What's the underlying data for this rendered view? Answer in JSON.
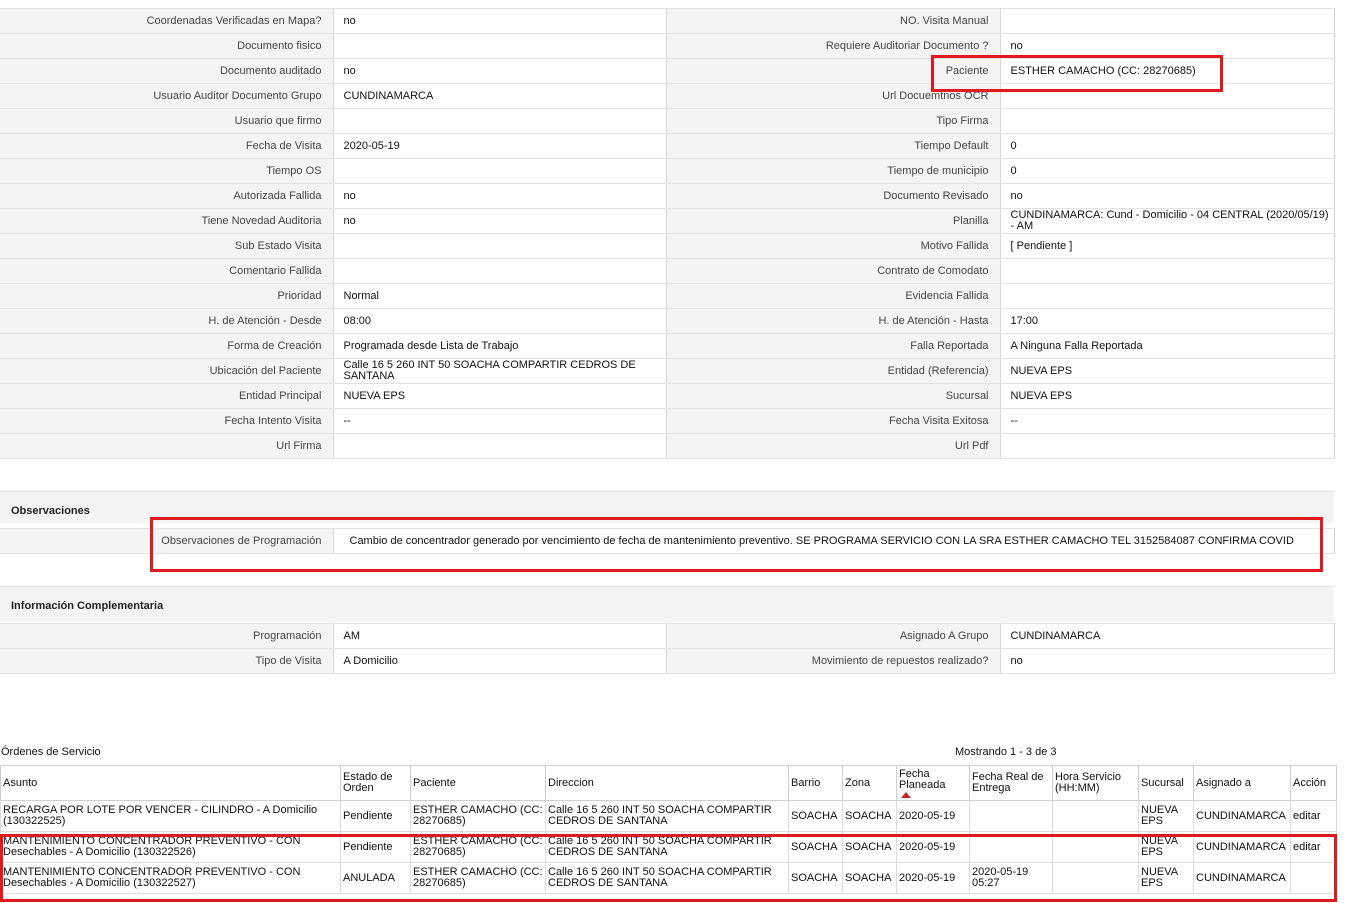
{
  "details": {
    "rows": [
      {
        "l1": "Coordenadas Verificadas en Mapa?",
        "v1": "no",
        "l2": "NO. Visita Manual",
        "v2": ""
      },
      {
        "l1": "Documento fisico",
        "v1": "",
        "l2": "Requiere Auditoriar Documento ?",
        "v2": "no"
      },
      {
        "l1": "Documento auditado",
        "v1": "no",
        "l2": "Paciente",
        "v2": "ESTHER CAMACHO (CC: 28270685)"
      },
      {
        "l1": "Usuario Auditor Documento Grupo",
        "v1": "CUNDINAMARCA",
        "l2": "Url Docuemtnos OCR",
        "v2": ""
      },
      {
        "l1": "Usuario que firmo",
        "v1": "",
        "l2": "Tipo Firma",
        "v2": ""
      },
      {
        "l1": "Fecha de Visita",
        "v1": "2020-05-19",
        "l2": "Tiempo Default",
        "v2": "0"
      },
      {
        "l1": "Tiempo OS",
        "v1": "",
        "l2": "Tiempo de municipio",
        "v2": "0"
      },
      {
        "l1": "Autorizada Fallida",
        "v1": "no",
        "l2": "Documento Revisado",
        "v2": "no"
      },
      {
        "l1": "Tiene Novedad Auditoria",
        "v1": "no",
        "l2": "Planilla",
        "v2": "CUNDINAMARCA: Cund - Domicilio - 04 CENTRAL (2020/05/19) - AM"
      },
      {
        "l1": "Sub Estado Visita",
        "v1": "",
        "l2": "Motivo Fallida",
        "v2": "[ Pendiente ]"
      },
      {
        "l1": "Comentario Fallida",
        "v1": "",
        "l2": "Contrato de Comodato",
        "v2": ""
      },
      {
        "l1": "Prioridad",
        "v1": "Normal",
        "l2": "Evidencia Fallida",
        "v2": ""
      },
      {
        "l1": "H. de Atención - Desde",
        "v1": "08:00",
        "l2": "H. de Atención - Hasta",
        "v2": "17:00"
      },
      {
        "l1": "Forma de Creación",
        "v1": "Programada desde Lista de Trabajo",
        "l2": "Falla Reportada",
        "v2": "A Ninguna Falla Reportada"
      },
      {
        "l1": "Ubicación del Paciente",
        "v1": "Calle 16 5 260 INT 50 SOACHA COMPARTIR CEDROS DE SANTANA",
        "l2": "Entidad (Referencia)",
        "v2": "NUEVA EPS"
      },
      {
        "l1": "Entidad Principal",
        "v1": "NUEVA EPS",
        "l2": "Sucursal",
        "v2": "NUEVA EPS"
      },
      {
        "l1": "Fecha Intento Visita",
        "v1": "--",
        "l2": "Fecha Visita Exitosa",
        "v2": "--"
      },
      {
        "l1": "Url Firma",
        "v1": "",
        "l2": "Url Pdf",
        "v2": ""
      }
    ]
  },
  "observaciones": {
    "title": "Observaciones",
    "label": "Observaciones de Programación",
    "value": "Cambio de concentrador generado por vencimiento de fecha de mantenimiento preventivo. SE PROGRAMA SERVICIO CON LA SRA ESTHER CAMACHO TEL 3152584087 CONFIRMA COVID"
  },
  "complementaria": {
    "title": "Información Complementaria",
    "rows": [
      {
        "l1": "Programación",
        "v1": "AM",
        "l2": "Asignado A Grupo",
        "v2": "CUNDINAMARCA"
      },
      {
        "l1": "Tipo de Visita",
        "v1": "A Domicilio",
        "l2": "Movimiento de repuestos realizado?",
        "v2": "no"
      }
    ]
  },
  "orders": {
    "title": "Órdenes de Servicio",
    "count": "Mostrando 1 - 3 de 3",
    "headers": [
      "Asunto",
      "Estado de Orden",
      "Paciente",
      "Direccion",
      "Barrio",
      "Zona",
      "Fecha Planeada",
      "Fecha Real de Entrega",
      "Hora Servicio (HH:MM)",
      "Sucursal",
      "Asignado a",
      "Acción"
    ],
    "rows": [
      {
        "asunto": "RECARGA POR LOTE POR VENCER - CILINDRO - A Domicilio (130322525)",
        "estado": "Pendiente",
        "paciente": "ESTHER CAMACHO (CC: 28270685)",
        "direccion": "Calle 16 5 260 INT 50 SOACHA COMPARTIR CEDROS DE SANTANA",
        "barrio": "SOACHA",
        "zona": "SOACHA",
        "fecha_planeada": "2020-05-19",
        "fecha_real": "",
        "hora": "",
        "sucursal": "NUEVA EPS",
        "asignado": "CUNDINAMARCA",
        "accion": "editar"
      },
      {
        "asunto": "MANTENIMIENTO CONCENTRADOR PREVENTIVO - CON Desechables - A Domicilio (130322526)",
        "estado": "Pendiente",
        "paciente": "ESTHER CAMACHO (CC: 28270685)",
        "direccion": "Calle 16 5 260 INT 50 SOACHA COMPARTIR CEDROS DE SANTANA",
        "barrio": "SOACHA",
        "zona": "SOACHA",
        "fecha_planeada": "2020-05-19",
        "fecha_real": "",
        "hora": "",
        "sucursal": "NUEVA EPS",
        "asignado": "CUNDINAMARCA",
        "accion": "editar"
      },
      {
        "asunto": "MANTENIMIENTO CONCENTRADOR PREVENTIVO - CON Desechables - A Domicilio (130322527)",
        "estado": "ANULADA",
        "paciente": "ESTHER CAMACHO (CC: 28270685)",
        "direccion": "Calle 16 5 260 INT 50 SOACHA COMPARTIR CEDROS DE SANTANA",
        "barrio": "SOACHA",
        "zona": "SOACHA",
        "fecha_planeada": "2020-05-19",
        "fecha_real": "2020-05-19 05:27",
        "hora": "",
        "sucursal": "NUEVA EPS",
        "asignado": "CUNDINAMARCA",
        "accion": ""
      }
    ]
  },
  "colors": {
    "highlight": "#e0191f",
    "label_bg": "#f4f4f4",
    "sort_arrow": "#c0262c"
  }
}
